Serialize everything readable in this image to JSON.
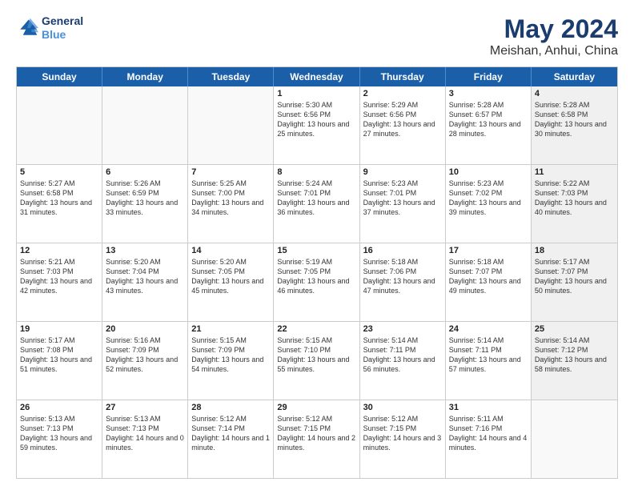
{
  "header": {
    "logo_line1": "General",
    "logo_line2": "Blue",
    "main_title": "May 2024",
    "subtitle": "Meishan, Anhui, China"
  },
  "days_of_week": [
    "Sunday",
    "Monday",
    "Tuesday",
    "Wednesday",
    "Thursday",
    "Friday",
    "Saturday"
  ],
  "weeks": [
    [
      {
        "day": "",
        "info": "",
        "empty": true
      },
      {
        "day": "",
        "info": "",
        "empty": true
      },
      {
        "day": "",
        "info": "",
        "empty": true
      },
      {
        "day": "1",
        "info": "Sunrise: 5:30 AM\nSunset: 6:56 PM\nDaylight: 13 hours\nand 25 minutes.",
        "empty": false
      },
      {
        "day": "2",
        "info": "Sunrise: 5:29 AM\nSunset: 6:56 PM\nDaylight: 13 hours\nand 27 minutes.",
        "empty": false
      },
      {
        "day": "3",
        "info": "Sunrise: 5:28 AM\nSunset: 6:57 PM\nDaylight: 13 hours\nand 28 minutes.",
        "empty": false
      },
      {
        "day": "4",
        "info": "Sunrise: 5:28 AM\nSunset: 6:58 PM\nDaylight: 13 hours\nand 30 minutes.",
        "empty": false,
        "shaded": true
      }
    ],
    [
      {
        "day": "5",
        "info": "Sunrise: 5:27 AM\nSunset: 6:58 PM\nDaylight: 13 hours\nand 31 minutes.",
        "empty": false
      },
      {
        "day": "6",
        "info": "Sunrise: 5:26 AM\nSunset: 6:59 PM\nDaylight: 13 hours\nand 33 minutes.",
        "empty": false
      },
      {
        "day": "7",
        "info": "Sunrise: 5:25 AM\nSunset: 7:00 PM\nDaylight: 13 hours\nand 34 minutes.",
        "empty": false
      },
      {
        "day": "8",
        "info": "Sunrise: 5:24 AM\nSunset: 7:01 PM\nDaylight: 13 hours\nand 36 minutes.",
        "empty": false
      },
      {
        "day": "9",
        "info": "Sunrise: 5:23 AM\nSunset: 7:01 PM\nDaylight: 13 hours\nand 37 minutes.",
        "empty": false
      },
      {
        "day": "10",
        "info": "Sunrise: 5:23 AM\nSunset: 7:02 PM\nDaylight: 13 hours\nand 39 minutes.",
        "empty": false
      },
      {
        "day": "11",
        "info": "Sunrise: 5:22 AM\nSunset: 7:03 PM\nDaylight: 13 hours\nand 40 minutes.",
        "empty": false,
        "shaded": true
      }
    ],
    [
      {
        "day": "12",
        "info": "Sunrise: 5:21 AM\nSunset: 7:03 PM\nDaylight: 13 hours\nand 42 minutes.",
        "empty": false
      },
      {
        "day": "13",
        "info": "Sunrise: 5:20 AM\nSunset: 7:04 PM\nDaylight: 13 hours\nand 43 minutes.",
        "empty": false
      },
      {
        "day": "14",
        "info": "Sunrise: 5:20 AM\nSunset: 7:05 PM\nDaylight: 13 hours\nand 45 minutes.",
        "empty": false
      },
      {
        "day": "15",
        "info": "Sunrise: 5:19 AM\nSunset: 7:05 PM\nDaylight: 13 hours\nand 46 minutes.",
        "empty": false
      },
      {
        "day": "16",
        "info": "Sunrise: 5:18 AM\nSunset: 7:06 PM\nDaylight: 13 hours\nand 47 minutes.",
        "empty": false
      },
      {
        "day": "17",
        "info": "Sunrise: 5:18 AM\nSunset: 7:07 PM\nDaylight: 13 hours\nand 49 minutes.",
        "empty": false
      },
      {
        "day": "18",
        "info": "Sunrise: 5:17 AM\nSunset: 7:07 PM\nDaylight: 13 hours\nand 50 minutes.",
        "empty": false,
        "shaded": true
      }
    ],
    [
      {
        "day": "19",
        "info": "Sunrise: 5:17 AM\nSunset: 7:08 PM\nDaylight: 13 hours\nand 51 minutes.",
        "empty": false
      },
      {
        "day": "20",
        "info": "Sunrise: 5:16 AM\nSunset: 7:09 PM\nDaylight: 13 hours\nand 52 minutes.",
        "empty": false
      },
      {
        "day": "21",
        "info": "Sunrise: 5:15 AM\nSunset: 7:09 PM\nDaylight: 13 hours\nand 54 minutes.",
        "empty": false
      },
      {
        "day": "22",
        "info": "Sunrise: 5:15 AM\nSunset: 7:10 PM\nDaylight: 13 hours\nand 55 minutes.",
        "empty": false
      },
      {
        "day": "23",
        "info": "Sunrise: 5:14 AM\nSunset: 7:11 PM\nDaylight: 13 hours\nand 56 minutes.",
        "empty": false
      },
      {
        "day": "24",
        "info": "Sunrise: 5:14 AM\nSunset: 7:11 PM\nDaylight: 13 hours\nand 57 minutes.",
        "empty": false
      },
      {
        "day": "25",
        "info": "Sunrise: 5:14 AM\nSunset: 7:12 PM\nDaylight: 13 hours\nand 58 minutes.",
        "empty": false,
        "shaded": true
      }
    ],
    [
      {
        "day": "26",
        "info": "Sunrise: 5:13 AM\nSunset: 7:13 PM\nDaylight: 13 hours\nand 59 minutes.",
        "empty": false
      },
      {
        "day": "27",
        "info": "Sunrise: 5:13 AM\nSunset: 7:13 PM\nDaylight: 14 hours\nand 0 minutes.",
        "empty": false
      },
      {
        "day": "28",
        "info": "Sunrise: 5:12 AM\nSunset: 7:14 PM\nDaylight: 14 hours\nand 1 minute.",
        "empty": false
      },
      {
        "day": "29",
        "info": "Sunrise: 5:12 AM\nSunset: 7:15 PM\nDaylight: 14 hours\nand 2 minutes.",
        "empty": false
      },
      {
        "day": "30",
        "info": "Sunrise: 5:12 AM\nSunset: 7:15 PM\nDaylight: 14 hours\nand 3 minutes.",
        "empty": false
      },
      {
        "day": "31",
        "info": "Sunrise: 5:11 AM\nSunset: 7:16 PM\nDaylight: 14 hours\nand 4 minutes.",
        "empty": false
      },
      {
        "day": "",
        "info": "",
        "empty": true,
        "shaded": true
      }
    ]
  ]
}
